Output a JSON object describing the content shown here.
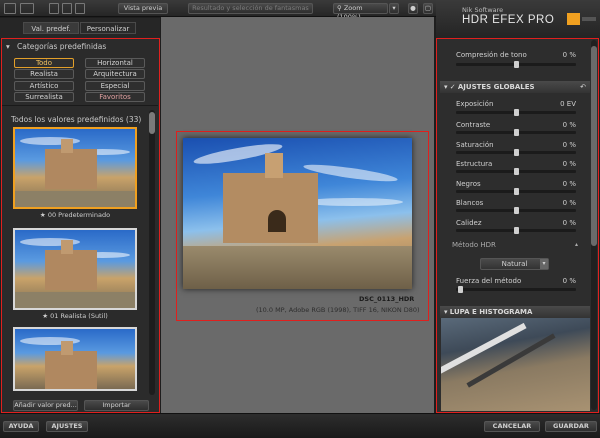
{
  "toolbar": {
    "preview_label": "Vista previa",
    "compare_label": "Resultado y selección de fantasmas",
    "zoom_label": "Zoom (100%)"
  },
  "brand": {
    "company": "Nik Software",
    "product": "HDR EFEX PRO"
  },
  "left_panel": {
    "tab_predef": "Val. predef.",
    "tab_custom": "Personalizar",
    "categories_title": "Categorías predefinidas",
    "categories": [
      "Todo",
      "Horizontal",
      "Realista",
      "Arquitectura",
      "Artístico",
      "Especial",
      "Surrealista",
      "Favoritos"
    ],
    "all_presets_title": "Todos los valores predefinidos (33)",
    "thumb_captions": [
      "00 Predeterminado",
      "01 Realista (Sutil)"
    ],
    "add_button": "Añadir valor pred...",
    "import_button": "Importar"
  },
  "center": {
    "filename": "DSC_0113_HDR",
    "meta": "(10.0 MP, Adobe RGB (1998), TIFF 16, NIKON D80)"
  },
  "right_panel": {
    "tone_compression_label": "Compresión de tono",
    "tone_compression_value": "0 %",
    "global_section": "AJUSTES GLOBALES",
    "sliders": [
      {
        "label": "Exposición",
        "value": "0 EV"
      },
      {
        "label": "Contraste",
        "value": "0 %"
      },
      {
        "label": "Saturación",
        "value": "0 %"
      },
      {
        "label": "Estructura",
        "value": "0 %"
      },
      {
        "label": "Negros",
        "value": "0 %"
      },
      {
        "label": "Blancos",
        "value": "0 %"
      },
      {
        "label": "Calidez",
        "value": "0 %"
      }
    ],
    "hdr_method_label": "Método HDR",
    "hdr_method_value": "Natural",
    "method_strength_label": "Fuerza del método",
    "method_strength_value": "0 %",
    "lupa_section": "LUPA E HISTOGRAMA"
  },
  "bottom": {
    "help": "AYUDA",
    "settings": "AJUSTES",
    "cancel": "CANCELAR",
    "save": "GUARDAR"
  },
  "colors": {
    "highlight_red": "#e0201e",
    "selected_orange": "#f0a020",
    "brand_orange": "#f0a020"
  }
}
